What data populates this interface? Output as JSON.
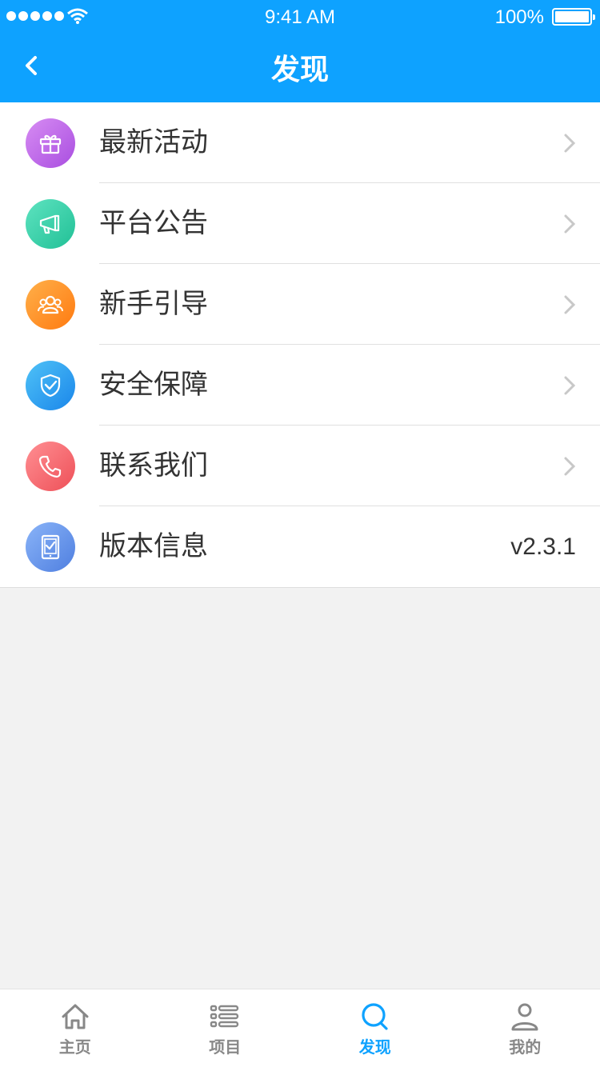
{
  "status_bar": {
    "time": "9:41 AM",
    "battery": "100%"
  },
  "nav": {
    "title": "发现"
  },
  "menu": [
    {
      "label": "最新活动",
      "icon": "gift-icon",
      "color": "#b95ee6"
    },
    {
      "label": "平台公告",
      "icon": "megaphone-icon",
      "color": "#2fd0a6"
    },
    {
      "label": "新手引导",
      "icon": "users-icon",
      "color": "#ff8a1e"
    },
    {
      "label": "安全保障",
      "icon": "shield-check-icon",
      "color": "#1e9af0"
    },
    {
      "label": "联系我们",
      "icon": "phone-icon",
      "color": "#f35f66"
    },
    {
      "label": "版本信息",
      "icon": "tablet-check-icon",
      "color": "#5c8ee8",
      "value": "v2.3.1"
    }
  ],
  "tabbar": {
    "tabs": [
      {
        "label": "主页",
        "icon": "home-icon"
      },
      {
        "label": "项目",
        "icon": "list-icon"
      },
      {
        "label": "发现",
        "icon": "search-icon",
        "active": true
      },
      {
        "label": "我的",
        "icon": "user-icon"
      }
    ],
    "active_color": "#0ea2ff",
    "inactive_color": "#888888"
  },
  "theme": {
    "header_color": "#0ea2ff",
    "background": "#f2f2f2"
  }
}
